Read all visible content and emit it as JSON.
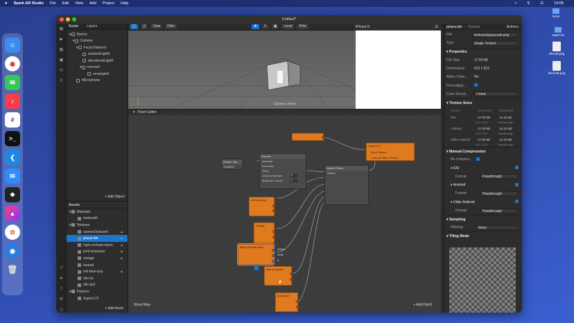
{
  "menubar": {
    "apple": "",
    "app": "Spark AR Studio",
    "items": [
      "File",
      "Edit",
      "View",
      "Add",
      "Project",
      "Help"
    ],
    "clock": "14:05"
  },
  "desktop": {
    "items": [
      {
        "label": "home",
        "kind": "folder"
      },
      {
        "label": "super-lut",
        "kind": "folder"
      },
      {
        "label": "rlks-lut.png",
        "kind": "file"
      },
      {
        "label": "rlks-lut2.png",
        "kind": "file"
      }
    ]
  },
  "window": {
    "title": "Untitled*"
  },
  "scene": {
    "tabs": [
      "Scene",
      "Layers"
    ],
    "items": [
      "Device",
      "Camera",
      "Focal Distance",
      "ambientLight0",
      "directionalLight0",
      "canvas0",
      "rectangle0",
      "Microphone"
    ],
    "add_label": "+ Add Object"
  },
  "assets": {
    "title": "Assets",
    "items": [
      {
        "label": "Materials",
        "group": true
      },
      {
        "label": "material0",
        "warn": false
      },
      {
        "label": "Textures",
        "group": true
      },
      {
        "label": "cameraTexture0",
        "warn": true
      },
      {
        "label": "grayscale",
        "warn": true,
        "selected": true
      },
      {
        "label": "high-contrast-warm",
        "warn": true
      },
      {
        "label": "pink-turquoise",
        "warn": true
      },
      {
        "label": "vintage",
        "warn": true
      },
      {
        "label": "neutral",
        "warn": false
      },
      {
        "label": "red-blue-pop",
        "warn": true
      },
      {
        "label": "rlks-lut",
        "warn": false
      },
      {
        "label": "rlks-lut2",
        "warn": false
      },
      {
        "label": "Patches",
        "group": true
      },
      {
        "label": "SuperLUT",
        "warn": false
      }
    ],
    "add_label": "+ Add Asset"
  },
  "viewport": {
    "view": "View",
    "filter": "Filter",
    "local": "Local",
    "print": "Print",
    "camera_label": "Camera: Front"
  },
  "preview": {
    "device": "iPhone 8"
  },
  "patch_editor": {
    "title": "Patch Editor",
    "show_map": "Show Map",
    "add_patch": "+ Add Patch",
    "screen_tap": {
      "title": "Screen Tap",
      "port": "Enabled"
    },
    "counter": {
      "title": "Counter",
      "rows": [
        "Increase",
        "Decrease",
        "Jump",
        "Jump to Number",
        "Maximum Count"
      ],
      "values": [
        "0",
        "3"
      ]
    },
    "option_picker": {
      "title": "Option Picker",
      "row": "Option"
    },
    "superlut": {
      "title": "SuperLUT",
      "rows": [
        "Input Texture",
        "Look-up Video Texture"
      ]
    },
    "nodes": [
      "red-blue-pop",
      "vintage",
      "high-contrast-warm",
      "pink-turquoise",
      "grayscale"
    ],
    "hcw_outputs": [
      "RGBA",
      "RGB",
      "A"
    ]
  },
  "inspector": {
    "title": "grayscale",
    "subtitle": "– Texture",
    "actions": "Actions",
    "file_label": "File",
    "file": "textures/grayscale.png",
    "type_label": "Type",
    "type": "Single Texture",
    "props_title": "Properties",
    "props": [
      {
        "k": "File Size",
        "v": "17.00 kB"
      },
      {
        "k": "Dimensions",
        "v": "512 x 512"
      },
      {
        "k": "Alpha Chan...",
        "v": "No"
      },
      {
        "k": "Premultiply...",
        "v": ""
      },
      {
        "k": "Color Encod...",
        "v": "Linear"
      }
    ],
    "sizes_title": "Texture Sizes",
    "sizes_head": [
      "Device",
      "On Device",
      "Download"
    ],
    "sizes": [
      {
        "d": "iOS",
        "a": "17.00 kB",
        "b": "14.16 kB",
        "sa": "512 x 512",
        "sb": "Passthrough"
      },
      {
        "d": "Android",
        "a": "17.00 kB",
        "b": "14.16 kB",
        "sa": "512 x 512",
        "sb": "Passthrough"
      },
      {
        "d": "Older Android",
        "a": "17.00 kB",
        "b": "14.16 kB",
        "sa": "512 x 512",
        "sb": "Passthrough"
      }
    ],
    "mc_title": "Manual Compression",
    "no_compress": "No compres...",
    "ios": "iOS",
    "android": "Android",
    "older_android": "Older Android",
    "format_label": "Format",
    "format": "Passthrough",
    "sampling_title": "Sampling",
    "filtering_label": "Filtering",
    "filtering": "None",
    "tiling_title": "Tiling Mode"
  }
}
